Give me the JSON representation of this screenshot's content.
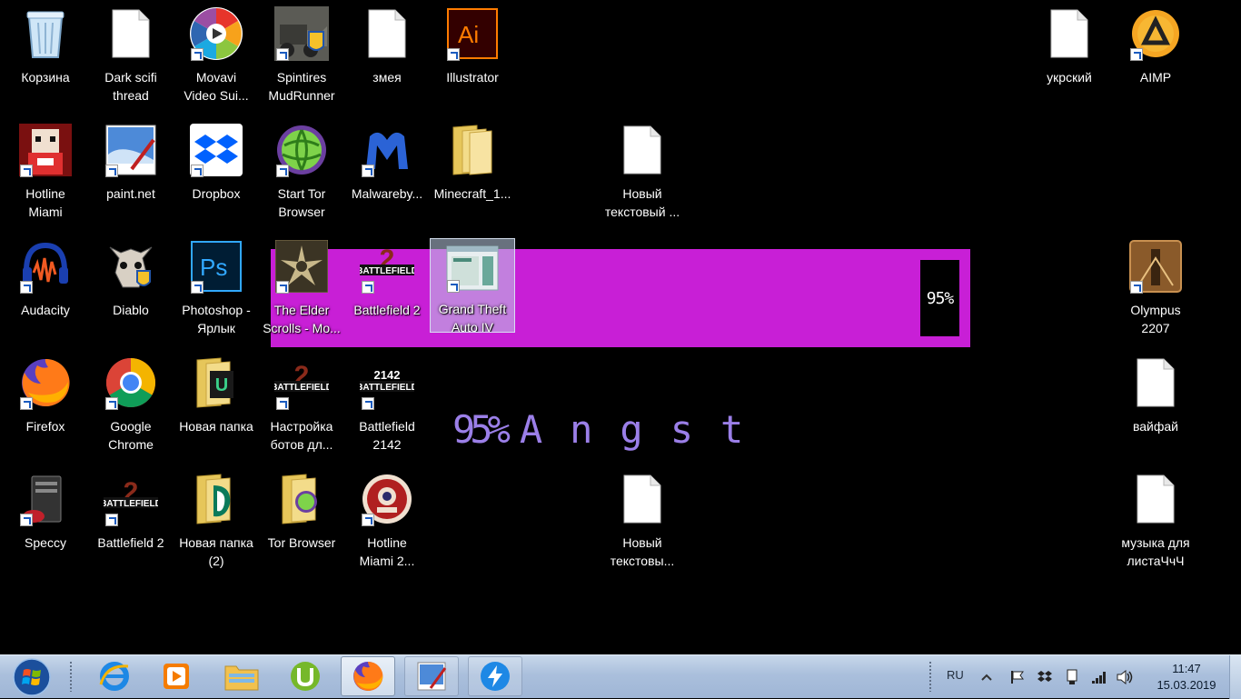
{
  "desktop": {
    "icons": [
      {
        "label": "Корзина",
        "icon": "recycle-bin-icon"
      },
      {
        "label": "Dark scifi\nthread",
        "icon": "text-file-icon"
      },
      {
        "label": "Movavi\nVideo Sui...",
        "icon": "movavi-icon"
      },
      {
        "label": "Spintires\nMudRunner",
        "icon": "spintires-icon"
      },
      {
        "label": "змея",
        "icon": "text-file-icon"
      },
      {
        "label": "Illustrator",
        "icon": "illustrator-icon"
      },
      {
        "label": "укрский",
        "icon": "text-file-icon"
      },
      {
        "label": "AIMP",
        "icon": "aimp-icon"
      },
      {
        "label": "Hotline\nMiami",
        "icon": "hotline-miami-icon"
      },
      {
        "label": "paint.net",
        "icon": "paint-net-icon"
      },
      {
        "label": "Dropbox",
        "icon": "dropbox-icon"
      },
      {
        "label": "Start Tor\nBrowser",
        "icon": "tor-icon"
      },
      {
        "label": "Malwareby...",
        "icon": "malwarebytes-icon"
      },
      {
        "label": "Minecraft_1...",
        "icon": "folder-icon"
      },
      {
        "label": "Новый\nтекстовый ...",
        "icon": "text-file-icon"
      },
      {
        "label": "Audacity",
        "icon": "audacity-icon"
      },
      {
        "label": "Diablo",
        "icon": "diablo-icon"
      },
      {
        "label": "Photoshop -\nЯрлык",
        "icon": "photoshop-icon"
      },
      {
        "label": "The Elder\nScrolls - Mo...",
        "icon": "elder-scrolls-icon"
      },
      {
        "label": "Battlefield 2",
        "icon": "battlefield-icon"
      },
      {
        "label": "Grand Theft\nAuto IV",
        "icon": "gta-icon"
      },
      {
        "label": "Olympus\n2207",
        "icon": "olympus-icon"
      },
      {
        "label": "Firefox",
        "icon": "firefox-icon"
      },
      {
        "label": "Google\nChrome",
        "icon": "chrome-icon"
      },
      {
        "label": "Новая папка",
        "icon": "folder-icon"
      },
      {
        "label": "Настройка\nботов дл...",
        "icon": "battlefield-icon"
      },
      {
        "label": "Battlefield\n2142",
        "icon": "battlefield-2142-icon"
      },
      {
        "label": "вайфай",
        "icon": "text-file-icon"
      },
      {
        "label": "Speccy",
        "icon": "speccy-icon"
      },
      {
        "label": "Battlefield 2",
        "icon": "battlefield-icon"
      },
      {
        "label": "Новая папка\n(2)",
        "icon": "folder-icon"
      },
      {
        "label": "Tor Browser",
        "icon": "folder-icon"
      },
      {
        "label": "Hotline\nMiami 2...",
        "icon": "hotline-miami-2-icon"
      },
      {
        "label": "Новый\nтекстовы...",
        "icon": "text-file-icon"
      },
      {
        "label": "музыка  для\nлистаЧчЧ",
        "icon": "text-file-icon"
      }
    ]
  },
  "widget": {
    "box_percent": "95%",
    "text_percent": "95%",
    "text_word": "Angst",
    "fill": 0.95,
    "bar_color": "#c81fd6",
    "text_color": "#9b7fe8"
  },
  "taskbar": {
    "pinned": [
      "internet-explorer-icon",
      "media-player-icon",
      "explorer-icon",
      "utorrent-icon",
      "firefox-icon",
      "paint-net-icon",
      "thunderbolt-icon"
    ],
    "language": "RU",
    "time": "11:47",
    "date": "15.03.2019"
  }
}
